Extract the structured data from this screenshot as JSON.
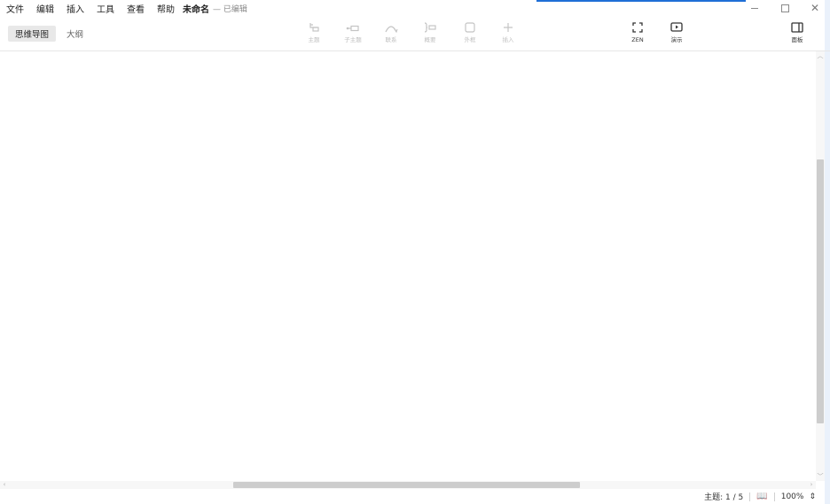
{
  "menu": [
    "文件",
    "编辑",
    "插入",
    "工具",
    "查看",
    "帮助"
  ],
  "document": {
    "title": "未命名",
    "status": "— 已编辑"
  },
  "view_tabs": [
    {
      "label": "思维导图",
      "active": true
    },
    {
      "label": "大纲",
      "active": false
    }
  ],
  "tools": [
    {
      "label": "主题",
      "icon": "topic-icon",
      "enabled": false
    },
    {
      "label": "子主题",
      "icon": "subtopic-icon",
      "enabled": false
    },
    {
      "label": "联系",
      "icon": "relationship-icon",
      "enabled": false
    },
    {
      "label": "概要",
      "icon": "summary-icon",
      "enabled": false
    },
    {
      "label": "外框",
      "icon": "boundary-icon",
      "enabled": false
    },
    {
      "label": "插入",
      "icon": "plus-icon",
      "enabled": false
    },
    {
      "label": "ZEN",
      "icon": "fullscreen-icon",
      "enabled": true
    },
    {
      "label": "演示",
      "icon": "play-icon",
      "enabled": true
    },
    {
      "label": "面板",
      "icon": "panel-icon",
      "enabled": true
    }
  ],
  "status": {
    "topics": "主题: 1 / 5",
    "zoom": "100%"
  },
  "colors": {
    "accent": "#1f6fd6"
  }
}
